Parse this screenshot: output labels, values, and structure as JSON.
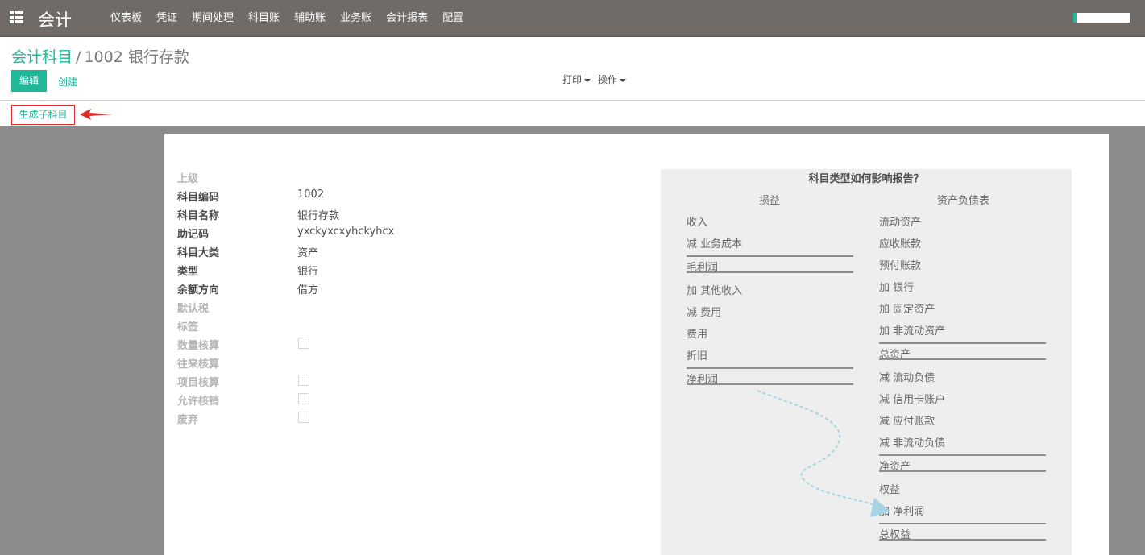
{
  "topbar": {
    "app_title": "会计",
    "menu": [
      "仪表板",
      "凭证",
      "期间处理",
      "科目账",
      "辅助账",
      "业务账",
      "会计报表",
      "配置"
    ]
  },
  "breadcrumb": {
    "parent": "会计科目",
    "separator": "/",
    "current": "1002 银行存款"
  },
  "control_panel": {
    "edit_label": "编辑",
    "create_label": "创建",
    "print_label": "打印",
    "action_label": "操作"
  },
  "statusbar": {
    "generate_child_label": "生成子科目"
  },
  "form": {
    "parent_label": "上级",
    "code_label": "科目编码",
    "code_value": "1002",
    "name_label": "科目名称",
    "name_value": "银行存款",
    "mnemonic_label": "助记码",
    "mnemonic_value": "yxckyxcxyhckyhcx",
    "category_label": "科目大类",
    "category_value": "资产",
    "type_label": "类型",
    "type_value": "银行",
    "balance_label": "余额方向",
    "balance_value": "借方",
    "tax_label": "默认税",
    "tags_label": "标签",
    "qty_label": "数量核算",
    "partner_label": "往来核算",
    "project_label": "项目核算",
    "reconcile_label": "允许核销",
    "deprecated_label": "废弃"
  },
  "help": {
    "title": "科目类型如何影响报告？",
    "pl_header": "损益",
    "bs_header": "资产负债表",
    "pl_rows": [
      "收入",
      "减 业务成本",
      "毛利润",
      "加 其他收入",
      "减 费用",
      "费用",
      "折旧",
      "净利润"
    ],
    "bs_rows": [
      "流动资产",
      "应收账款",
      "预付账款",
      "加 银行",
      "加 固定资产",
      "加 非流动资产",
      "总资产",
      "减 流动负债",
      "减 信用卡账户",
      "减 应付账款",
      "减 非流动负债",
      "净资产",
      "权益",
      "加 净利润",
      "总权益"
    ]
  },
  "colors": {
    "topbar": "#706b66",
    "accent": "#21b799",
    "highlight_border": "#e02b2b",
    "backdrop": "#8c8c8c",
    "help_bg": "#eeeeee",
    "flow_arrow": "#a6d4e2"
  }
}
